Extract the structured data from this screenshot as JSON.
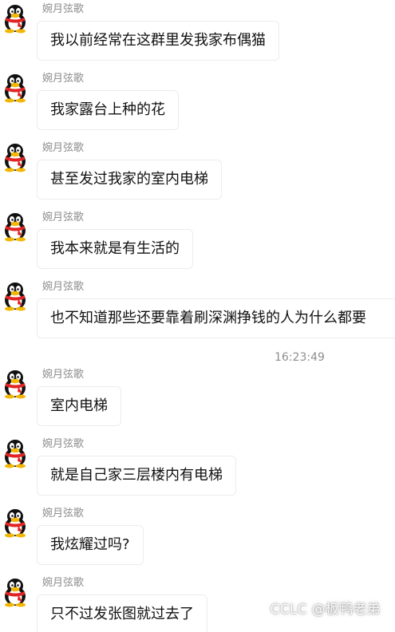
{
  "messages": [
    {
      "sender": "婉月弦歌",
      "text": "我以前经常在这群里发我家布偶猫"
    },
    {
      "sender": "婉月弦歌",
      "text": "我家露台上种的花"
    },
    {
      "sender": "婉月弦歌",
      "text": "甚至发过我家的室内电梯"
    },
    {
      "sender": "婉月弦歌",
      "text": "我本来就是有生活的"
    },
    {
      "sender": "婉月弦歌",
      "text": "也不知道那些还要靠着刷深渊挣钱的人为什么都要"
    },
    {
      "sender": "婉月弦歌",
      "text": "室内电梯"
    },
    {
      "sender": "婉月弦歌",
      "text": "就是自己家三层楼内有电梯"
    },
    {
      "sender": "婉月弦歌",
      "text": "我炫耀过吗?"
    },
    {
      "sender": "婉月弦歌",
      "text": "只不过发张图就过去了"
    }
  ],
  "timestamp": "16:23:49",
  "watermark": "CCLC @板鸭老弟",
  "avatar_icon": "qq-penguin-icon",
  "colors": {
    "sender_text": "#8c8c8c",
    "bubble_border": "#ececec",
    "message_text": "#111111",
    "timestamp_text": "#8e8e8e"
  }
}
